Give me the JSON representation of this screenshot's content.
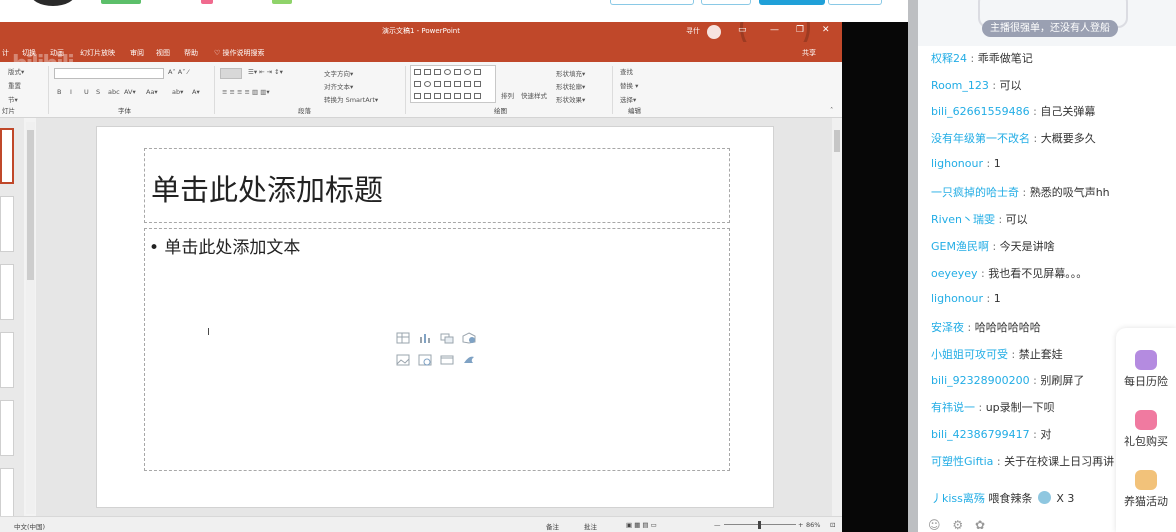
{
  "ppt": {
    "title": "演示文稿1  -  PowerPoint",
    "user": "寻什",
    "share": "共享",
    "watermark": "bilibili 直播",
    "window_controls": [
      "▭",
      "—",
      "❐",
      "✕"
    ],
    "tabs": [
      "计",
      "切换",
      "动画",
      "幻灯片放映",
      "审阅",
      "视图",
      "帮助",
      "♡ 操作说明搜索"
    ],
    "ribbon": {
      "clipboard": [
        "版式▾",
        "重置",
        "节▾"
      ],
      "slide_label": "灯片",
      "font_group": "字体",
      "paragraph_group": "段落",
      "drawing_group": "绘图",
      "editing_group": "编辑",
      "text_direction": "文字方向▾",
      "align_text": "对齐文本▾",
      "smartart": "转换为 SmartArt▾",
      "arrange": "排列",
      "quick_styles": "快速样式",
      "shape_fill": "形状填充▾",
      "shape_outline": "形状轮廓▾",
      "shape_effects": "形状效果▾",
      "find": "查找",
      "replace": "替换 ▾",
      "select": "选择▾",
      "font_buttons": [
        "B",
        "I",
        "U",
        "S",
        "abc",
        "AV▾",
        "Aa▾",
        "A▾"
      ]
    },
    "slide": {
      "title_placeholder": "单击此处添加标题",
      "body_placeholder": "• 单击此处添加文本"
    },
    "status": {
      "language": "中文(中国)",
      "notes": "备注",
      "comments": "批注",
      "zoom": "86%"
    }
  },
  "chat": {
    "banner": "主播很强单，还没有人登船",
    "messages": [
      {
        "user": "权释24",
        "text": "乖乖做笔记"
      },
      {
        "user": "Room_123",
        "text": "可以"
      },
      {
        "user": "bili_62661559486",
        "text": "自己关弹幕"
      },
      {
        "user": "没有年级第一不改名",
        "text": "大概要多久"
      },
      {
        "user": "lighonour",
        "text": "1"
      },
      {
        "user": "一只疯掉的哈士奇",
        "text": "熟悉的吸气声hh"
      },
      {
        "user": "Riven丶瑞雯",
        "text": "可以"
      },
      {
        "user": "GEM渔民啊",
        "text": "今天是讲啥"
      },
      {
        "user": "oeyeyey",
        "text": "我也看不见屏幕。。。"
      },
      {
        "user": "lighonour",
        "text": "1"
      },
      {
        "user": "安泽夜",
        "text": "哈哈哈哈哈哈"
      },
      {
        "user": "小姐姐可攻可受",
        "text": "禁止套娃"
      },
      {
        "user": "bili_92328900200",
        "text": "别刷屏了"
      },
      {
        "user": "有祎说一",
        "text": "up录制一下呗"
      },
      {
        "user": "bili_42386799417",
        "text": "对"
      },
      {
        "user": "可塑性Giftia",
        "text": "关于在校课上日习再讲"
      }
    ],
    "gift": {
      "user": "丿kiss离殇",
      "action": "喂食辣条",
      "count": "X 3"
    },
    "side_items": [
      "每日历险",
      "礼包购买",
      "养猫活动"
    ]
  }
}
